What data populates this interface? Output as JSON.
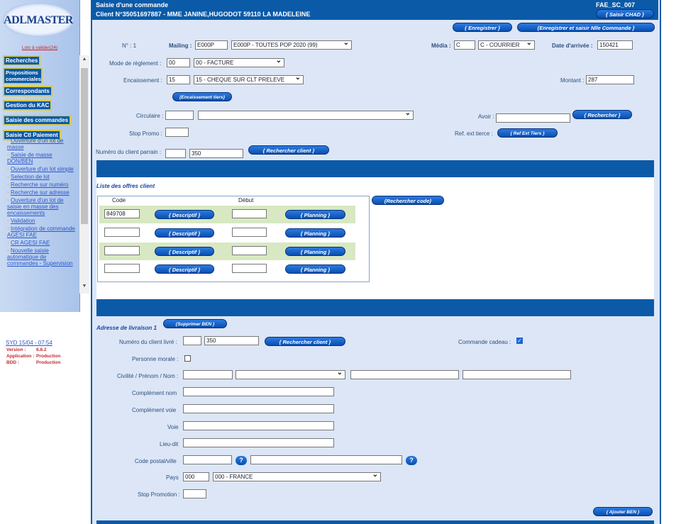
{
  "sidebar": {
    "logo": "ADLMASTER",
    "lots_link": "Lots à valider(24)",
    "menu": [
      "Recherches",
      "Propositions commerciales",
      "Correspondants",
      "Gestion du KAC",
      "Saisie des commandes",
      "Saisie Ctl Paiement"
    ],
    "sublinks": [
      "Ouverture d'un lot de masse",
      "Saisie de masse DON/BEN",
      "Ouverture d'un lot simple",
      "Selection de lot",
      "Recherche sur numéro",
      "Recherche sur adresse",
      "Ouverture d'un lot de saisie en masse des encaissements",
      "Validation",
      "Intégration de commande AGESI FAE",
      "CR AGESI FAE",
      "Nouvelle saisie automatique de commandes - Supervision"
    ],
    "footer": {
      "syd": "SYD 15/04 - 07:54",
      "version_label": "Version :",
      "version_value": "6.8.2",
      "application_label": "Application :",
      "application_value": "Production",
      "bdd_label": "BDD :",
      "bdd_value": "Production"
    }
  },
  "header": {
    "title": "Saisie d'une commande",
    "client": "Client N°35051697887 - MME JANINE,HUGODOT 59110 LA MADELEINE",
    "code": "FAE_SC_007",
    "saisir_chad": "{ Saisir CHAD }",
    "enregistrer": "{ Enregistrer }",
    "enregistrer_nlle": "{Enregistrer et saisir Nlle Commande }"
  },
  "form": {
    "numero_label": "N° : 1",
    "mailing_label": "Mailing :",
    "mailing_code": "E000P",
    "mailing_select": "E000P - TOUTES POP 2020 (99)",
    "media_label": "Média :",
    "media_code": "C",
    "media_select": "C - COURRIER",
    "date_label": "Date d'arrivée :",
    "date_value": "150421",
    "mode_label": "Mode de règlement :",
    "mode_code": "00",
    "mode_select": "00 - FACTURE",
    "encaissement_label": "Encaissement :",
    "encaissement_code": "15",
    "encaissement_select": "15 - CHEQUE SUR CLT PRELEVE",
    "montant_label": "Montant :",
    "montant_value": "287",
    "encaissement_tiers_btn": "{Encaissement tiers}",
    "circulaire_label": "Circulaire :",
    "avoir_label": "Avoir :",
    "rechercher_btn": "{ Rechercher }",
    "stop_promo_label": "Stop Promo :",
    "ref_ext_label": "Ref. ext tierce :",
    "ref_ext_btn": "{ Ref Ext Tiers }",
    "parrain_label": "Numéro du client parrain :",
    "parrain_value": "350",
    "rechercher_client_btn": "{ Rechercher client }"
  },
  "offres": {
    "title": "Liste des offres client",
    "col_code": "Code",
    "col_debut": "Début",
    "rechercher_code_btn": "{Rechercher code}",
    "rows": [
      {
        "code": "849708",
        "descriptif": "{ Descriptif }",
        "planning": "{ Planning }"
      },
      {
        "code": "",
        "descriptif": "{ Descriptif }",
        "planning": "{ Planning }"
      },
      {
        "code": "",
        "descriptif": "{ Descriptif }",
        "planning": "{ Planning }"
      },
      {
        "code": "",
        "descriptif": "{ Descriptif }",
        "planning": "{ Planning }"
      }
    ]
  },
  "livraison": {
    "title": "Adresse de livraison 1",
    "supprimer_btn": "{Supprimer BEN }",
    "numero_label": "Numéro du client livré :",
    "numero_value": "350",
    "rechercher_client_btn": "{ Rechercher client }",
    "cadeau_label": "Commande cadeau :",
    "personne_morale_label": "Personne morale :",
    "civilite_label": "Civilité / Prénom / Nom :",
    "complement_nom_label": "Complément nom",
    "complement_voie_label": "Complément voie",
    "voie_label": "Voie",
    "lieu_dit_label": "Lieu-dit",
    "cp_label": "Code postal/ville",
    "pays_label": "Pays",
    "pays_code": "000",
    "pays_select": "000 - FRANCE",
    "stop_promotion_label": "Stop Promotion :",
    "ajouter_btn": "{ Ajouter BEN }"
  }
}
